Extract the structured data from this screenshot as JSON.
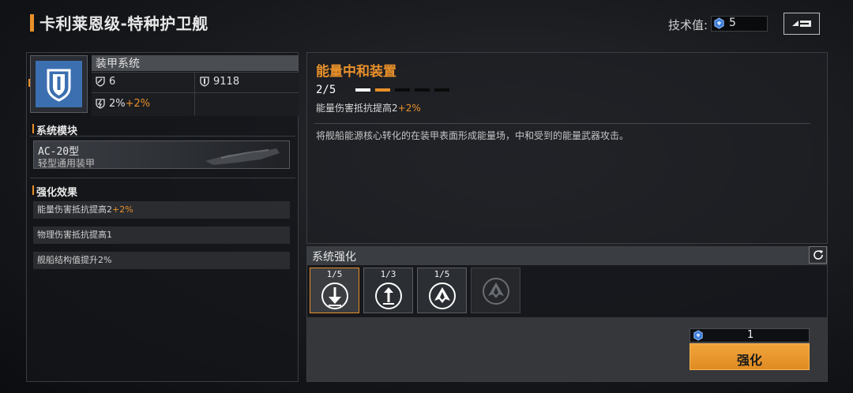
{
  "header": {
    "title": "卡利莱恩级-特种护卫舰",
    "tech_label": "技术值:",
    "tech_value": "5"
  },
  "left": {
    "armor_title": "装甲系统",
    "stat_a": "6",
    "stat_b": "9118",
    "stat_c_base": "2%",
    "stat_c_bonus": "+2%",
    "module_section": "系统模块",
    "module_name": "AC-20型",
    "module_sub": "轻型通用装甲",
    "effects_section": "强化效果",
    "effects": [
      {
        "text": "能量伤害抵抗提高2",
        "bonus": "+2%"
      },
      {
        "text": "物理伤害抵抗提高1",
        "bonus": ""
      },
      {
        "text": "舰船结构值提升2%",
        "bonus": ""
      }
    ]
  },
  "device": {
    "title": "能量中和装置",
    "level": "2/5",
    "level_fraction": 0.4,
    "bonus_text": "能量伤害抵抗提高2",
    "bonus_value": "+2%",
    "description": "将舰船能源核心转化的在装甲表面形成能量场，中和受到的能量武器攻击。"
  },
  "enhance": {
    "title": "系统强化",
    "slots": [
      {
        "level": "1/5",
        "icon": "arrow-down-icon",
        "active": true
      },
      {
        "level": "1/3",
        "icon": "arrow-up-icon",
        "active": false
      },
      {
        "level": "1/5",
        "icon": "ship-icon",
        "active": false
      },
      {
        "level": "",
        "icon": "ship-locked-icon",
        "active": false
      }
    ],
    "cost": "1",
    "button_label": "强化"
  },
  "colors": {
    "accent": "#e8902a",
    "icon_blue": "#3c6fb0"
  }
}
